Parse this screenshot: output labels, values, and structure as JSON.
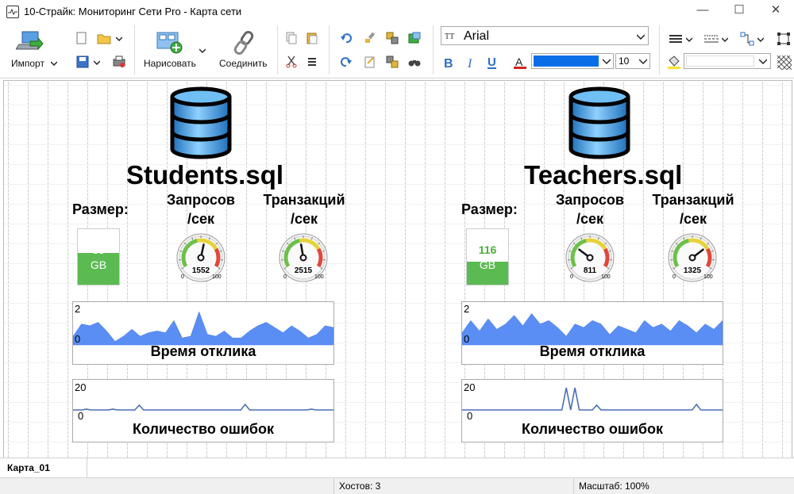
{
  "window": {
    "title": "10-Страйк: Мониторинг Сети Pro - Карта сети",
    "minimize": "—",
    "maximize": "☐",
    "close": "✕"
  },
  "toolbar": {
    "import_label": "Импорт",
    "draw_label": "Нарисовать",
    "connect_label": "Соединить",
    "font_name": "Arial",
    "font_size": "10",
    "color_accent": "#0a6ee6"
  },
  "hosts": [
    {
      "name": "Students.sql",
      "size_label": "Размер:",
      "size_value": "35",
      "size_unit": "GB",
      "size_fill": 0.57,
      "requests_label_1": "Запросов",
      "requests_label_2": "/сек",
      "requests_value": "1552",
      "requests_level": 0.55,
      "trans_label_1": "Транзакций",
      "trans_label_2": "/сек",
      "trans_value": "2515",
      "trans_level": 0.46,
      "gauge_min": "0",
      "gauge_max": "100",
      "response_title": "Время отклика",
      "response_ymax": "2",
      "response_ymin": "0",
      "response_values": [
        0.25,
        0.6,
        0.55,
        0.65,
        0.4,
        0.1,
        0.25,
        0.45,
        0.25,
        0.35,
        0.4,
        0.35,
        0.7,
        0.2,
        0.25,
        0.95,
        0.3,
        0.25,
        0.4,
        0.2,
        0.2,
        0.4,
        0.55,
        0.65,
        0.5,
        0.35,
        0.55,
        0.4,
        0.2,
        0.3,
        0.55,
        0.5
      ],
      "errors_title": "Количество ошибок",
      "errors_ymax": "20",
      "errors_ymin": "0",
      "errors_values": [
        5,
        5,
        5,
        5.5,
        5,
        5,
        5,
        5,
        5,
        5.5,
        5,
        5,
        5,
        5,
        5,
        8,
        5,
        5,
        5,
        5,
        5,
        5,
        5,
        5,
        5,
        5,
        5,
        5,
        5,
        5,
        5,
        5,
        5,
        5,
        5,
        5,
        5,
        5,
        5,
        8.5,
        5,
        5,
        5,
        5,
        5,
        5,
        5,
        5,
        5,
        5,
        5,
        5,
        5,
        5,
        5.5,
        5,
        5,
        5,
        5,
        5
      ]
    },
    {
      "name": "Teachers.sql",
      "size_label": "Размер:",
      "size_value": "116",
      "size_unit": "GB",
      "size_fill": 0.42,
      "requests_label_1": "Запросов",
      "requests_label_2": "/сек",
      "requests_value": "811",
      "requests_level": 0.28,
      "trans_label_1": "Транзакций",
      "trans_label_2": "/сек",
      "trans_value": "1325",
      "trans_level": 0.72,
      "gauge_min": "0",
      "gauge_max": "100",
      "response_title": "Время отклика",
      "response_ymax": "2",
      "response_ymin": "0",
      "response_values": [
        0.35,
        0.7,
        0.4,
        0.75,
        0.45,
        0.6,
        0.85,
        0.55,
        0.9,
        0.6,
        0.7,
        0.5,
        0.25,
        0.6,
        0.5,
        0.7,
        0.6,
        0.3,
        0.55,
        0.45,
        0.35,
        0.7,
        0.5,
        0.6,
        0.4,
        0.7,
        0.55,
        0.35,
        0.6,
        0.45,
        0.7
      ],
      "errors_title": "Количество ошибок",
      "errors_ymax": "20",
      "errors_ymin": "0",
      "errors_values": [
        5,
        5,
        5,
        5,
        5,
        5,
        5,
        5,
        5,
        5,
        5,
        5,
        5,
        5,
        5,
        5,
        5,
        5,
        5,
        5,
        5,
        5,
        5,
        5,
        19,
        5,
        19,
        5,
        5,
        5,
        5,
        8,
        5,
        5,
        5,
        5,
        5,
        5,
        5,
        5,
        5,
        5,
        5,
        5,
        5,
        5,
        5,
        5,
        5,
        5,
        5,
        5,
        5,
        5,
        8.5,
        5,
        5,
        5,
        5,
        5,
        5
      ]
    }
  ],
  "tabs": [
    {
      "label": "Карта_01"
    }
  ],
  "status": {
    "hosts": "Хостов: 3",
    "zoom": "Масштаб: 100%"
  }
}
